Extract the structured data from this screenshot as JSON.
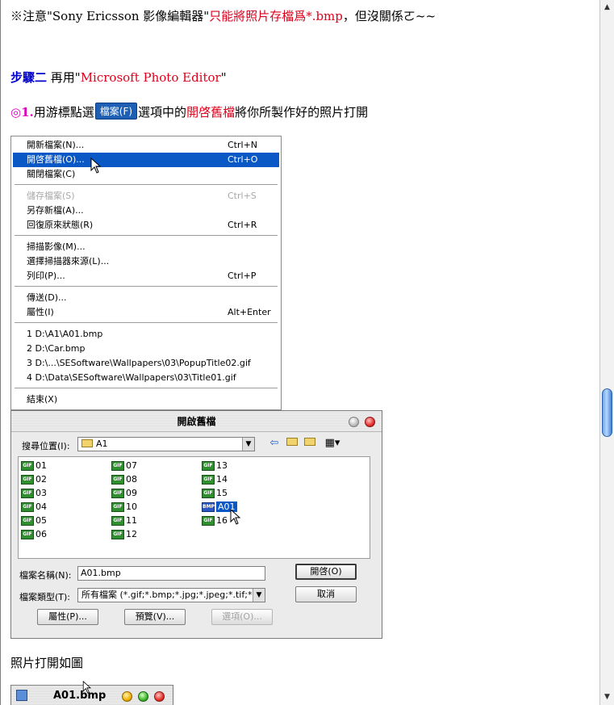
{
  "intro": {
    "prefix": "※注意\"Sony Ericsson 影像編輯器\"",
    "red_part": "只能將照片存檔爲*.bmp",
    "suffix": "，但沒關係ㄛ~~"
  },
  "step2": {
    "label": "步驟二",
    "text": " 再用\"",
    "app_name": "Microsoft Photo Editor",
    "close_quote": "\""
  },
  "instruction": {
    "number": "◎1.",
    "text1": "用游標點選",
    "button_label": "檔案(F)",
    "text2": "選項中的",
    "highlight": "開啓舊檔",
    "text3": "將你所製作好的照片打開"
  },
  "menu": {
    "items": [
      {
        "label": "開新檔案(N)...",
        "shortcut": "Ctrl+N"
      },
      {
        "label": "開啓舊檔(O)...",
        "shortcut": "Ctrl+O"
      },
      {
        "label": "關閉檔案(C)",
        "shortcut": ""
      },
      {
        "label": "儲存檔案(S)",
        "shortcut": "Ctrl+S"
      },
      {
        "label": "另存新檔(A)...",
        "shortcut": ""
      },
      {
        "label": "回復原來狀態(R)",
        "shortcut": "Ctrl+R"
      },
      {
        "label": "掃描影像(M)...",
        "shortcut": ""
      },
      {
        "label": "選擇掃描器來源(L)...",
        "shortcut": ""
      },
      {
        "label": "列印(P)...",
        "shortcut": "Ctrl+P"
      },
      {
        "label": "傳送(D)...",
        "shortcut": ""
      },
      {
        "label": "屬性(I)",
        "shortcut": "Alt+Enter"
      },
      {
        "label": "1 D:\\A1\\A01.bmp",
        "shortcut": ""
      },
      {
        "label": "2 D:\\Car.bmp",
        "shortcut": ""
      },
      {
        "label": "3 D:\\...\\SESoftware\\Wallpapers\\03\\PopupTitle02.gif",
        "shortcut": ""
      },
      {
        "label": "4 D:\\Data\\SESoftware\\Wallpapers\\03\\Title01.gif",
        "shortcut": ""
      },
      {
        "label": "結束(X)",
        "shortcut": ""
      }
    ]
  },
  "dialog": {
    "title": "開啟舊檔",
    "lookin_label": "搜尋位置(I):",
    "lookin_value": "A1",
    "files": [
      {
        "name": "01",
        "type": "GIF"
      },
      {
        "name": "02",
        "type": "GIF"
      },
      {
        "name": "03",
        "type": "GIF"
      },
      {
        "name": "04",
        "type": "GIF"
      },
      {
        "name": "05",
        "type": "GIF"
      },
      {
        "name": "06",
        "type": "GIF"
      },
      {
        "name": "07",
        "type": "GIF"
      },
      {
        "name": "08",
        "type": "GIF"
      },
      {
        "name": "09",
        "type": "GIF"
      },
      {
        "name": "10",
        "type": "GIF"
      },
      {
        "name": "11",
        "type": "GIF"
      },
      {
        "name": "12",
        "type": "GIF"
      },
      {
        "name": "13",
        "type": "GIF"
      },
      {
        "name": "14",
        "type": "GIF"
      },
      {
        "name": "15",
        "type": "GIF"
      },
      {
        "name": "A01",
        "type": "BMP"
      },
      {
        "name": "16",
        "type": "GIF"
      }
    ],
    "filename_label": "檔案名稱(N):",
    "filename_value": "A01.bmp",
    "filetype_label": "檔案類型(T):",
    "filetype_value": "所有檔案 (*.gif;*.bmp;*.jpg;*.jpeg;*.tif;*.p",
    "open_button": "開啓(O)",
    "cancel_button": "取消",
    "properties_button": "屬性(P)...",
    "preview_button": "預覽(V)...",
    "options_button": "選項(O)..."
  },
  "caption": "照片打開如圖",
  "window2": {
    "title": "A01.bmp"
  }
}
